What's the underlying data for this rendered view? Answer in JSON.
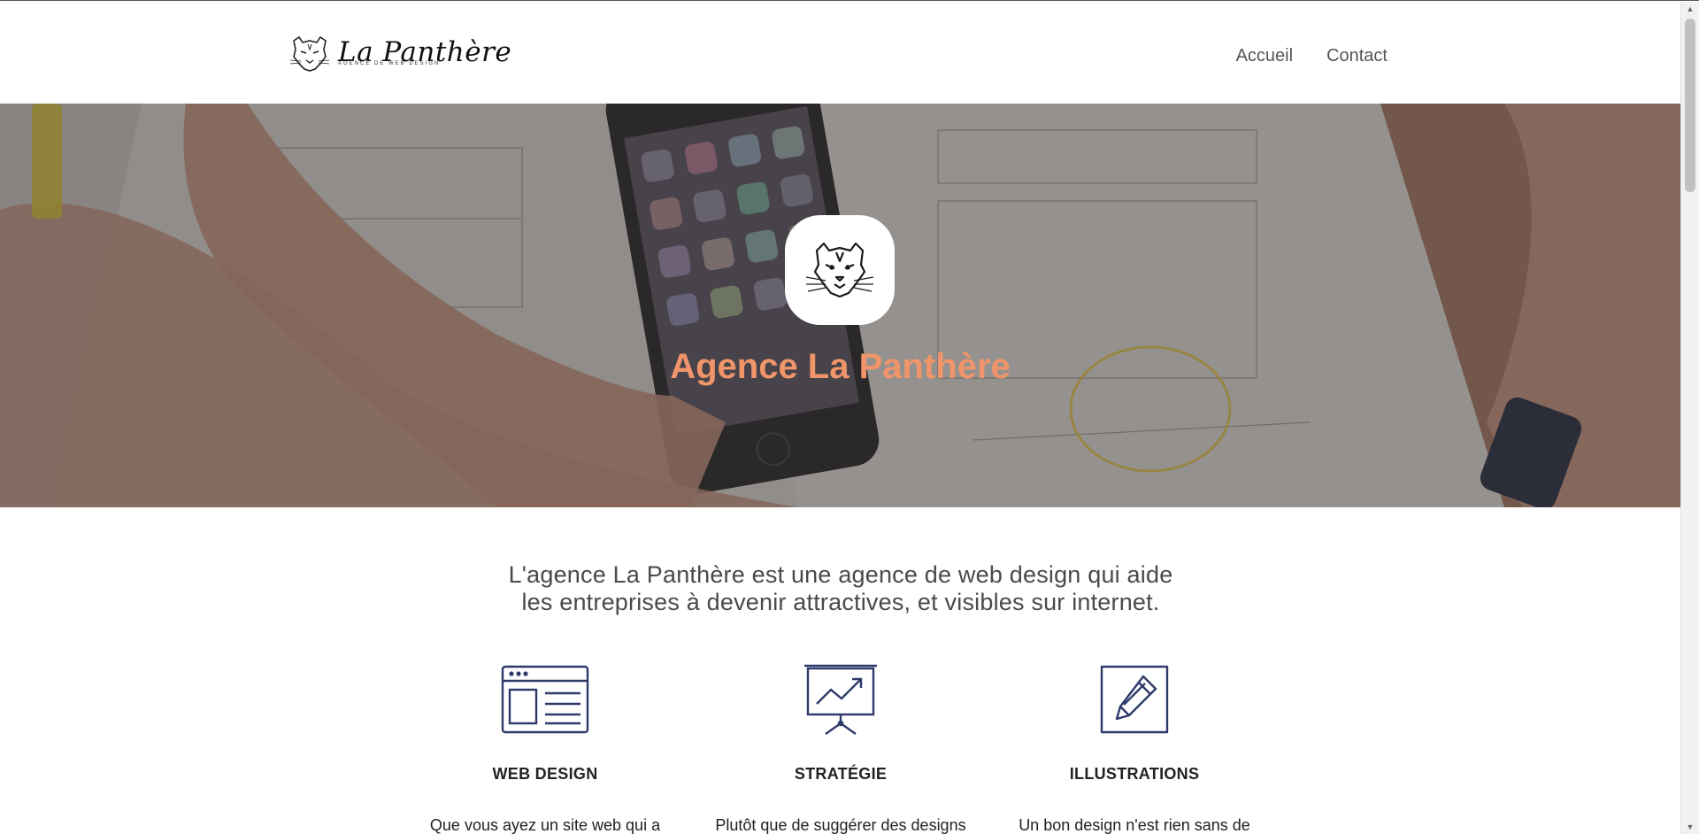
{
  "header": {
    "logo": {
      "name": "La Panthère",
      "tagline": "AGENCE DE WEB DESIGN"
    },
    "nav": [
      {
        "label": "Accueil"
      },
      {
        "label": "Contact"
      }
    ]
  },
  "hero": {
    "title": "Agence La Panthère"
  },
  "intro": {
    "line1": "L'agence La Panthère est une agence de web design qui aide",
    "line2": "les entreprises à devenir attractives, et visibles sur internet."
  },
  "services": [
    {
      "title": "WEB DESIGN",
      "text": "Que vous ayez un site web qui a",
      "icon": "browser-window-icon"
    },
    {
      "title": "STRATÉGIE",
      "text": "Plutôt que de suggérer des designs",
      "icon": "presentation-chart-icon"
    },
    {
      "title": "ILLUSTRATIONS",
      "text": "Un bon design n'est rien sans de",
      "icon": "pencil-icon"
    }
  ],
  "colors": {
    "accent": "#f0956a",
    "icon": "#2f3a6b",
    "text": "#4a4a4a"
  }
}
